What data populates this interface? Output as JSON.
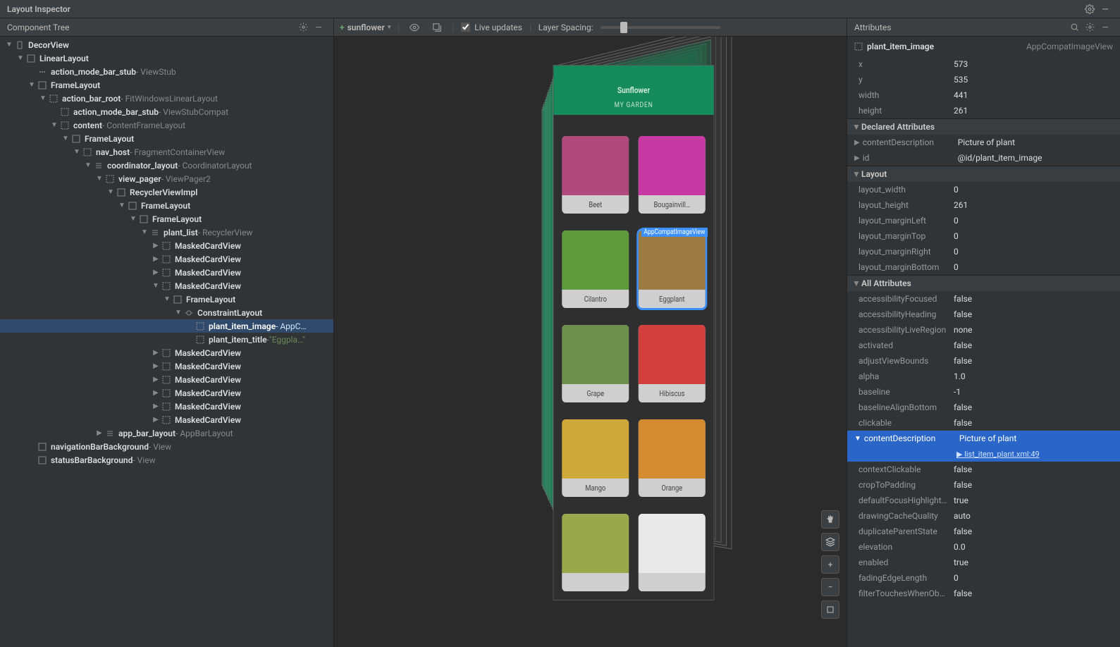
{
  "title": "Layout Inspector",
  "left": {
    "header": "Component Tree",
    "tree": [
      {
        "d": 0,
        "t": "expander",
        "open": true,
        "icon": "device",
        "id": "DecorView",
        "type": ""
      },
      {
        "d": 1,
        "t": "expander",
        "open": true,
        "icon": "box",
        "id": "LinearLayout",
        "type": ""
      },
      {
        "d": 2,
        "t": "leaf",
        "icon": "dots",
        "id": "action_mode_bar_stub",
        "type": "ViewStub"
      },
      {
        "d": 2,
        "t": "expander",
        "open": true,
        "icon": "box",
        "id": "FrameLayout",
        "type": ""
      },
      {
        "d": 3,
        "t": "expander",
        "open": true,
        "icon": "box-dash",
        "id": "action_bar_root",
        "type": "FitWindowsLinearLayout"
      },
      {
        "d": 4,
        "t": "leaf",
        "icon": "box-dash",
        "id": "action_mode_bar_stub",
        "type": "ViewStubCompat"
      },
      {
        "d": 4,
        "t": "expander",
        "open": true,
        "icon": "box-dash",
        "id": "content",
        "type": "ContentFrameLayout"
      },
      {
        "d": 5,
        "t": "expander",
        "open": true,
        "icon": "box",
        "id": "FrameLayout",
        "type": ""
      },
      {
        "d": 6,
        "t": "expander",
        "open": true,
        "icon": "box-dash",
        "id": "nav_host",
        "type": "FragmentContainerView"
      },
      {
        "d": 7,
        "t": "expander",
        "open": true,
        "icon": "list",
        "id": "coordinator_layout",
        "type": "CoordinatorLayout"
      },
      {
        "d": 8,
        "t": "expander",
        "open": true,
        "icon": "box-dash",
        "id": "view_pager",
        "type": "ViewPager2"
      },
      {
        "d": 9,
        "t": "expander",
        "open": true,
        "icon": "box",
        "id": "RecyclerViewImpl",
        "type": ""
      },
      {
        "d": 10,
        "t": "expander",
        "open": true,
        "icon": "box",
        "id": "FrameLayout",
        "type": ""
      },
      {
        "d": 11,
        "t": "expander",
        "open": true,
        "icon": "box",
        "id": "FrameLayout",
        "type": ""
      },
      {
        "d": 12,
        "t": "expander",
        "open": true,
        "icon": "list",
        "id": "plant_list",
        "type": "RecyclerView"
      },
      {
        "d": 13,
        "t": "collapsed",
        "icon": "box-dash",
        "id": "MaskedCardView",
        "type": ""
      },
      {
        "d": 13,
        "t": "collapsed",
        "icon": "box-dash",
        "id": "MaskedCardView",
        "type": ""
      },
      {
        "d": 13,
        "t": "collapsed",
        "icon": "box-dash",
        "id": "MaskedCardView",
        "type": ""
      },
      {
        "d": 13,
        "t": "expander",
        "open": true,
        "icon": "box-dash",
        "id": "MaskedCardView",
        "type": ""
      },
      {
        "d": 14,
        "t": "expander",
        "open": true,
        "icon": "box",
        "id": "FrameLayout",
        "type": ""
      },
      {
        "d": 15,
        "t": "expander",
        "open": true,
        "icon": "constraint",
        "id": "ConstraintLayout",
        "type": ""
      },
      {
        "d": 16,
        "t": "leaf",
        "selected": true,
        "icon": "box-dash",
        "id": "plant_item_image",
        "type": "AppC…"
      },
      {
        "d": 16,
        "t": "leaf",
        "icon": "box-dash",
        "id": "plant_item_title",
        "type": "",
        "value": "\"Eggpla…\""
      },
      {
        "d": 13,
        "t": "collapsed",
        "icon": "box-dash",
        "id": "MaskedCardView",
        "type": ""
      },
      {
        "d": 13,
        "t": "collapsed",
        "icon": "box-dash",
        "id": "MaskedCardView",
        "type": ""
      },
      {
        "d": 13,
        "t": "collapsed",
        "icon": "box-dash",
        "id": "MaskedCardView",
        "type": ""
      },
      {
        "d": 13,
        "t": "collapsed",
        "icon": "box-dash",
        "id": "MaskedCardView",
        "type": ""
      },
      {
        "d": 13,
        "t": "collapsed",
        "icon": "box-dash",
        "id": "MaskedCardView",
        "type": ""
      },
      {
        "d": 13,
        "t": "collapsed",
        "icon": "box-dash",
        "id": "MaskedCardView",
        "type": ""
      },
      {
        "d": 8,
        "t": "collapsed",
        "icon": "list",
        "id": "app_bar_layout",
        "type": "AppBarLayout"
      },
      {
        "d": 2,
        "t": "leaf",
        "icon": "box",
        "id": "navigationBarBackground",
        "type": "View"
      },
      {
        "d": 2,
        "t": "leaf",
        "icon": "box",
        "id": "statusBarBackground",
        "type": "View"
      }
    ]
  },
  "toolbar": {
    "process": "sunflower",
    "live_updates": "Live updates",
    "layer_spacing": "Layer Spacing:"
  },
  "preview": {
    "app_title": "Sunflower",
    "tab_label": "MY GARDEN",
    "selection_tag": "AppCompatImageView",
    "cards": [
      {
        "name": "Beet",
        "bg": "#b04a7c"
      },
      {
        "name": "Bougainvill…",
        "bg": "#c83aa3"
      },
      {
        "name": "Cilantro",
        "bg": "#5f9a3c"
      },
      {
        "name": "Eggplant",
        "bg": "#9c7b45",
        "selected": true
      },
      {
        "name": "Grape",
        "bg": "#6e8f4d"
      },
      {
        "name": "Hibiscus",
        "bg": "#d33e3e"
      },
      {
        "name": "Mango",
        "bg": "#cfa83c"
      },
      {
        "name": "Orange",
        "bg": "#d48b2f"
      },
      {
        "name": "",
        "bg": "#9aa84c"
      },
      {
        "name": "",
        "bg": "#e9e9e9"
      }
    ]
  },
  "right": {
    "header": "Attributes",
    "selected_id": "plant_item_image",
    "selected_class": "AppCompatImageView",
    "basic": [
      {
        "k": "x",
        "v": "573"
      },
      {
        "k": "y",
        "v": "535"
      },
      {
        "k": "width",
        "v": "441"
      },
      {
        "k": "height",
        "v": "261"
      }
    ],
    "declared_title": "Declared Attributes",
    "declared": [
      {
        "k": "contentDescription",
        "v": "Picture of plant",
        "caret": true
      },
      {
        "k": "id",
        "v": "@id/plant_item_image",
        "caret": true
      }
    ],
    "layout_title": "Layout",
    "layout": [
      {
        "k": "layout_width",
        "v": "0"
      },
      {
        "k": "layout_height",
        "v": "261"
      },
      {
        "k": "layout_marginLeft",
        "v": "0"
      },
      {
        "k": "layout_marginTop",
        "v": "0"
      },
      {
        "k": "layout_marginRight",
        "v": "0"
      },
      {
        "k": "layout_marginBottom",
        "v": "0"
      }
    ],
    "all_title": "All Attributes",
    "all": [
      {
        "k": "accessibilityFocused",
        "v": "false"
      },
      {
        "k": "accessibilityHeading",
        "v": "false"
      },
      {
        "k": "accessibilityLiveRegion",
        "v": "none"
      },
      {
        "k": "activated",
        "v": "false"
      },
      {
        "k": "adjustViewBounds",
        "v": "false"
      },
      {
        "k": "alpha",
        "v": "1.0"
      },
      {
        "k": "baseline",
        "v": "-1"
      },
      {
        "k": "baselineAlignBottom",
        "v": "false"
      },
      {
        "k": "clickable",
        "v": "false"
      },
      {
        "k": "contentDescription",
        "v": "Picture of plant",
        "selected": true,
        "link": "list_item_plant.xml:49"
      },
      {
        "k": "contextClickable",
        "v": "false"
      },
      {
        "k": "cropToPadding",
        "v": "false"
      },
      {
        "k": "defaultFocusHighlight…",
        "v": "true"
      },
      {
        "k": "drawingCacheQuality",
        "v": "auto"
      },
      {
        "k": "duplicateParentState",
        "v": "false"
      },
      {
        "k": "elevation",
        "v": "0.0"
      },
      {
        "k": "enabled",
        "v": "true"
      },
      {
        "k": "fadingEdgeLength",
        "v": "0"
      },
      {
        "k": "filterTouchesWhenOb…",
        "v": "false"
      }
    ]
  }
}
